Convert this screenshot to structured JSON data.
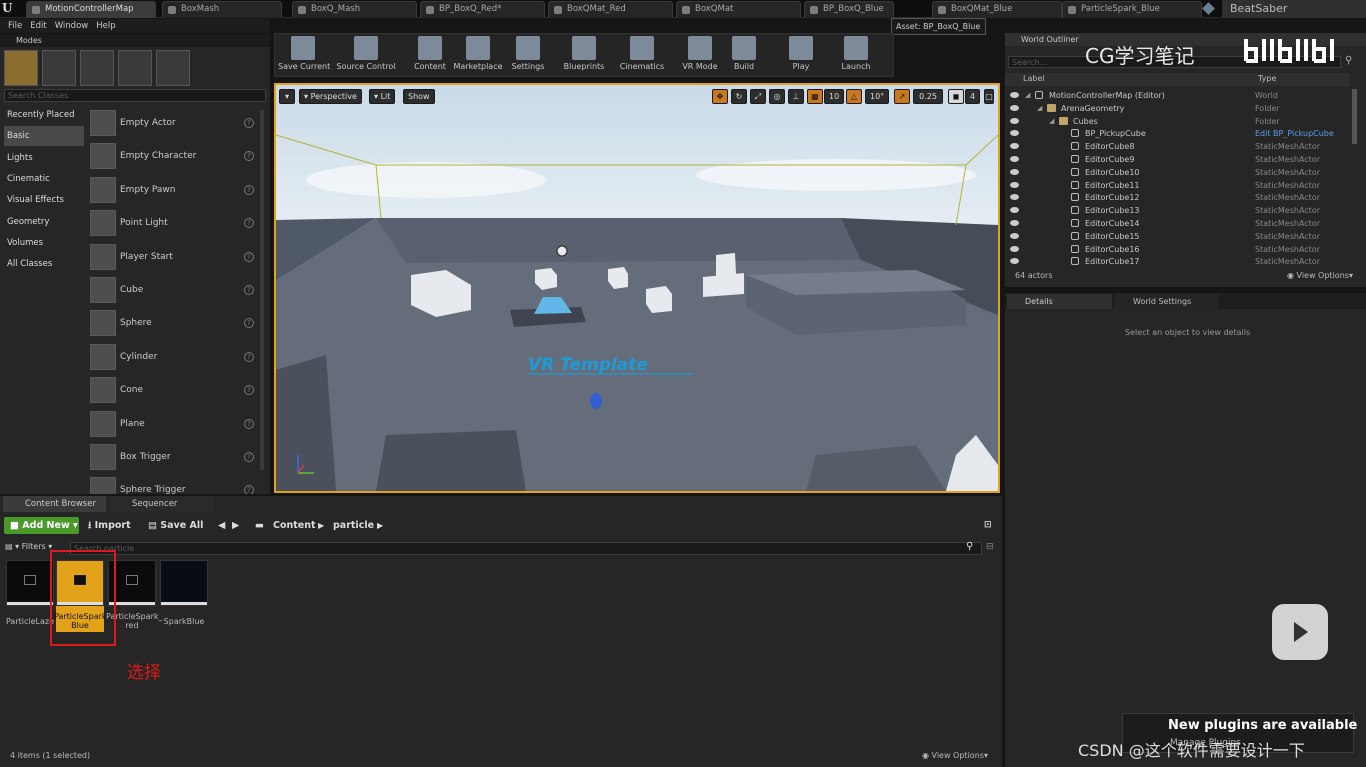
{
  "tabs": [
    {
      "label": "MotionControllerMap",
      "active": true
    },
    {
      "label": "BoxMash",
      "active": false
    },
    {
      "label": "BoxQ_Mash",
      "active": false
    },
    {
      "label": "BP_BoxQ_Red*",
      "active": false
    },
    {
      "label": "BoxQMat_Red",
      "active": false
    },
    {
      "label": "BoxQMat",
      "active": false
    },
    {
      "label": "BP_BoxQ_Blue",
      "active": false
    },
    {
      "label": "BoxQMat_Blue",
      "active": false
    },
    {
      "label": "ParticleSpark_Blue",
      "active": false
    }
  ],
  "project_name": "BeatSaber",
  "tooltip": "Asset: BP_BoxQ_Blue",
  "menu": [
    "File",
    "Edit",
    "Window",
    "Help"
  ],
  "modes": {
    "title": "Modes",
    "search_placeholder": "Search Classes",
    "categories": [
      "Recently Placed",
      "Basic",
      "Lights",
      "Cinematic",
      "Visual Effects",
      "Geometry",
      "Volumes",
      "All Classes"
    ],
    "selected_category": "Basic",
    "items": [
      "Empty Actor",
      "Empty Character",
      "Empty Pawn",
      "Point Light",
      "Player Start",
      "Cube",
      "Sphere",
      "Cylinder",
      "Cone",
      "Plane",
      "Box Trigger",
      "Sphere Trigger"
    ]
  },
  "toolbar": {
    "buttons": [
      "Save Current",
      "Source Control",
      "Content",
      "Marketplace",
      "Settings",
      "Blueprints",
      "Cinematics",
      "VR Mode",
      "Build",
      "Play",
      "Launch"
    ]
  },
  "viewport": {
    "perspective": "Perspective",
    "lit": "Lit",
    "show": "Show",
    "grid_snap": "10",
    "rot_snap": "10°",
    "scale_snap": "0.25",
    "cam_speed": "4",
    "world_text": "VR Template"
  },
  "outliner": {
    "title": "World Outliner",
    "search_placeholder": "Search...",
    "col_label": "Label",
    "col_type": "Type",
    "rows": [
      {
        "name": "MotionControllerMap (Editor)",
        "type": "World",
        "depth": 0,
        "kind": "world"
      },
      {
        "name": "ArenaGeometry",
        "type": "Folder",
        "depth": 1,
        "kind": "folder"
      },
      {
        "name": "Cubes",
        "type": "Folder",
        "depth": 2,
        "kind": "folder"
      },
      {
        "name": "BP_PickupCube",
        "type": "Edit BP_PickupCube",
        "depth": 3,
        "kind": "bp"
      },
      {
        "name": "EditorCube8",
        "type": "StaticMeshActor",
        "depth": 3,
        "kind": "actor"
      },
      {
        "name": "EditorCube9",
        "type": "StaticMeshActor",
        "depth": 3,
        "kind": "actor"
      },
      {
        "name": "EditorCube10",
        "type": "StaticMeshActor",
        "depth": 3,
        "kind": "actor"
      },
      {
        "name": "EditorCube11",
        "type": "StaticMeshActor",
        "depth": 3,
        "kind": "actor"
      },
      {
        "name": "EditorCube12",
        "type": "StaticMeshActor",
        "depth": 3,
        "kind": "actor"
      },
      {
        "name": "EditorCube13",
        "type": "StaticMeshActor",
        "depth": 3,
        "kind": "actor"
      },
      {
        "name": "EditorCube14",
        "type": "StaticMeshActor",
        "depth": 3,
        "kind": "actor"
      },
      {
        "name": "EditorCube15",
        "type": "StaticMeshActor",
        "depth": 3,
        "kind": "actor"
      },
      {
        "name": "EditorCube16",
        "type": "StaticMeshActor",
        "depth": 3,
        "kind": "actor"
      },
      {
        "name": "EditorCube17",
        "type": "StaticMeshActor",
        "depth": 3,
        "kind": "actor"
      }
    ],
    "count": "64 actors",
    "view_options": "View Options"
  },
  "details": {
    "tab_details": "Details",
    "tab_world": "World Settings",
    "empty": "Select an object to view details"
  },
  "content_browser": {
    "tab": "Content Browser",
    "tab2": "Sequencer",
    "add_new": "Add New",
    "import": "Import",
    "save_all": "Save All",
    "path": [
      "Content",
      "particle"
    ],
    "filters": "Filters",
    "search_placeholder": "Search particle",
    "assets": [
      {
        "name": "ParticleLaze",
        "selected": false
      },
      {
        "name": "ParticleSpark_ Blue",
        "selected": true
      },
      {
        "name": "ParticleSpark_ red",
        "selected": false
      },
      {
        "name": "SparkBlue",
        "selected": false
      }
    ],
    "status": "4 items (1 selected)",
    "view_options": "View Options"
  },
  "annotation": "选择",
  "watermark_title": "CG学习笔记",
  "notification": "New plugins are available",
  "notification_sub": "Manage Plugins",
  "footer_watermark": "CSDN @这个软件需要设计一下",
  "colors": {
    "accent": "#e2a31b",
    "selection": "#e01a1a",
    "link": "#5a9fe8"
  }
}
